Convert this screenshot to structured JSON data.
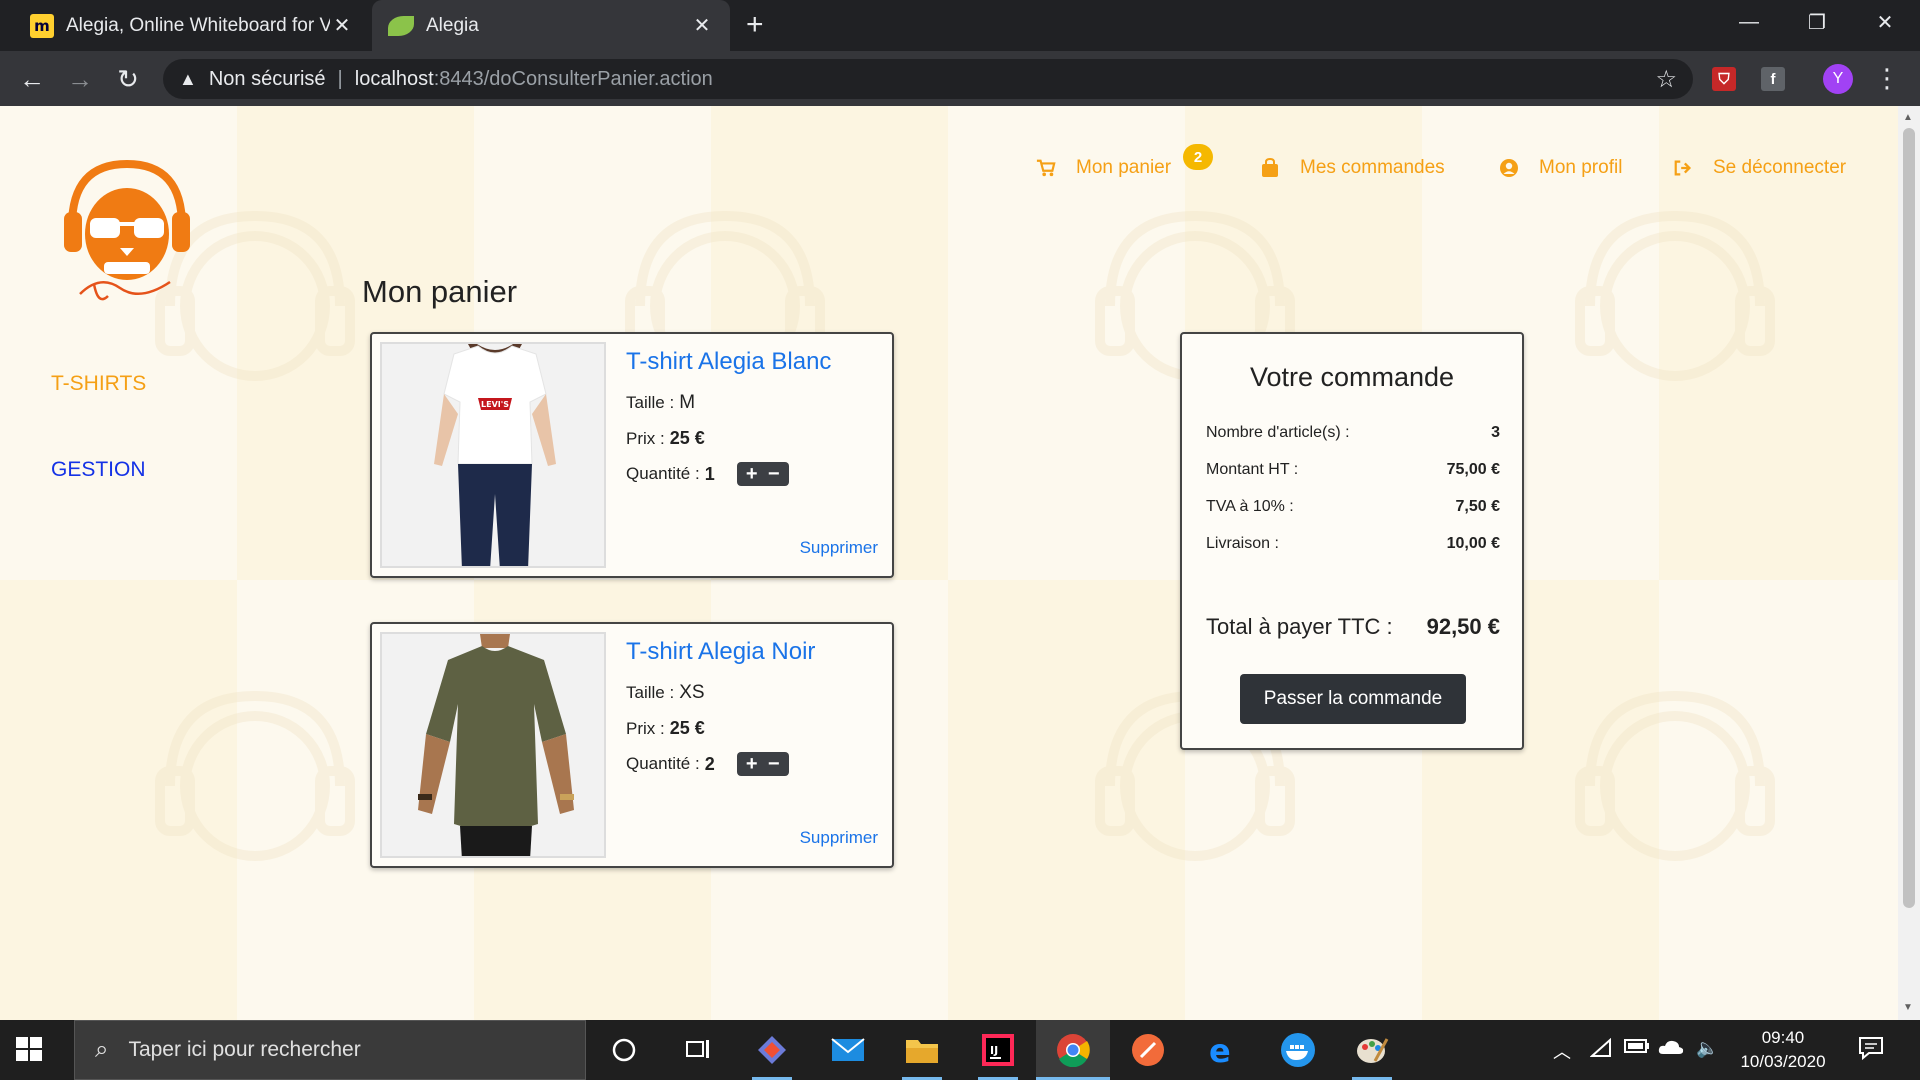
{
  "browser": {
    "tabs": [
      {
        "title": "Alegia, Online Whiteboard for Vis",
        "active": false
      },
      {
        "title": "Alegia",
        "active": true
      }
    ],
    "address": {
      "security_label": "Non sécurisé",
      "host": "localhost",
      "path": ":8443/doConsulterPanier.action"
    },
    "profile_initial": "Y"
  },
  "site": {
    "nav": {
      "cart_label": "Mon panier",
      "cart_count": "2",
      "orders_label": "Mes commandes",
      "profile_label": "Mon profil",
      "logout_label": "Se déconnecter"
    },
    "sidebar": {
      "items": [
        {
          "label": "T-SHIRTS"
        },
        {
          "label": "GESTION"
        }
      ]
    },
    "page_title": "Mon panier",
    "cart_items": [
      {
        "name": "T-shirt Alegia Blanc",
        "size_label": "Taille :",
        "size": "M",
        "price_label": "Prix :",
        "price": "25 €",
        "qty_label": "Quantité :",
        "qty": "1",
        "delete_label": "Supprimer"
      },
      {
        "name": "T-shirt Alegia Noir",
        "size_label": "Taille :",
        "size": "XS",
        "price_label": "Prix :",
        "price": "25 €",
        "qty_label": "Quantité :",
        "qty": "2",
        "delete_label": "Supprimer"
      }
    ],
    "summary": {
      "title": "Votre commande",
      "lines": [
        {
          "label": "Nombre d'article(s) :",
          "value": "3"
        },
        {
          "label": "Montant HT :",
          "value": "75,00 €"
        },
        {
          "label": "TVA à 10% :",
          "value": "7,50 €"
        },
        {
          "label": "Livraison :",
          "value": "10,00 €"
        }
      ],
      "total_label": "Total à payer TTC :",
      "total_value": "92,50 €",
      "button_label": "Passer la commande"
    }
  },
  "taskbar": {
    "search_placeholder": "Taper ici pour rechercher",
    "time": "09:40",
    "date": "10/03/2020"
  },
  "colors": {
    "accent_orange": "#f5a015",
    "link_blue": "#1a73e8",
    "gestion_blue": "#1432e6"
  }
}
